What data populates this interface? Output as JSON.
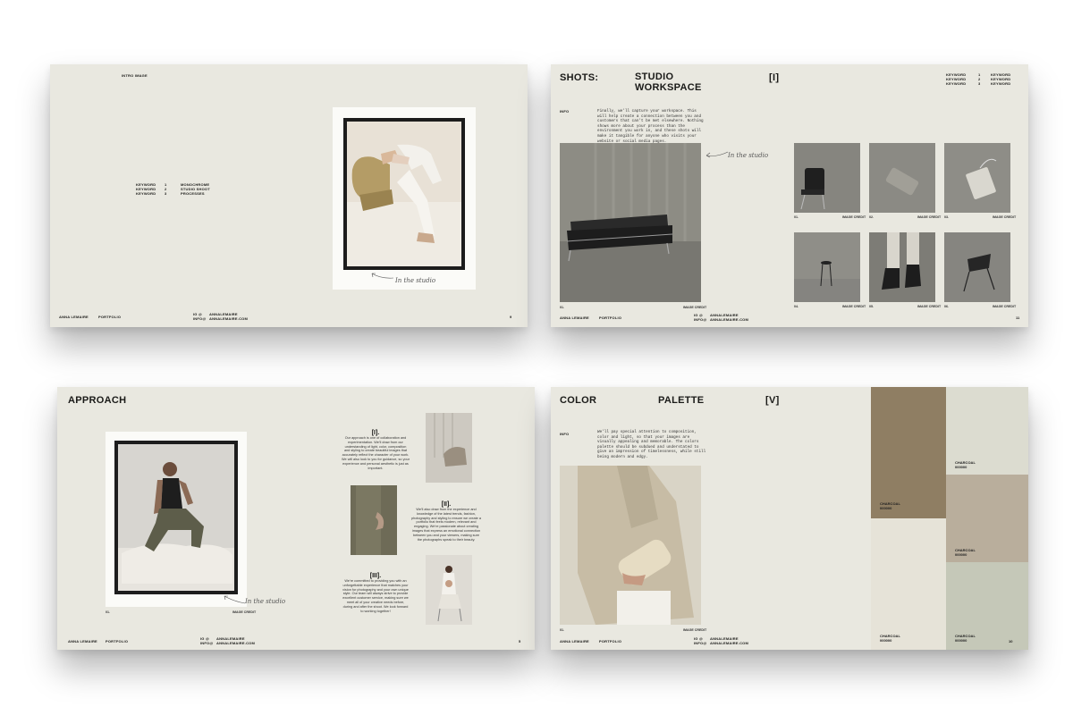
{
  "common": {
    "author": "ANNA LEMAIRE",
    "portfolio": "PORTFOLIO",
    "contact_labels": [
      "IG @",
      "INFO@"
    ],
    "contact_values": [
      "ANNALEMAIRE",
      "ANNALEMAIRE.COM"
    ],
    "studio_script": "In the studio",
    "image_credit": "IMAGE CREDIT",
    "info_label": "INFO"
  },
  "slide1": {
    "label": "INTRO IMAGE",
    "keywords_left": [
      "KEYWORD",
      "KEYWORD",
      "KEYWORD"
    ],
    "keywords_index": [
      "1",
      "2",
      "3"
    ],
    "keywords_right": [
      "MONOCHROME",
      "STUDIO SHOOT",
      "PROCESSES"
    ],
    "page": "9"
  },
  "slide2": {
    "title_left": "SHOTS:",
    "title_mid": "STUDIO WORKSPACE",
    "roman": "[I]",
    "keywords_left": [
      "KEYWORD",
      "KEYWORD",
      "KEYWORD"
    ],
    "keywords_index": [
      "1",
      "2",
      "3"
    ],
    "keywords_right": [
      "KEYWORD",
      "KEYWORD",
      "KEYWORD"
    ],
    "body": "Finally, we'll capture your workspace. This will help create a connection between you and customers that can't be met elsewhere. Nothing shows more about your process than the environment you work in, and these shots will make it tangible for anyone who visits your website or social media pages.",
    "grid_captions": [
      "01.",
      "02.",
      "03.",
      "04.",
      "05.",
      "06."
    ],
    "main_caption": "01.",
    "page": "11"
  },
  "slide3": {
    "title": "APPROACH",
    "sections": [
      {
        "roman": "[I].",
        "text": "Our approach is one of collaboration and experimentation. We'll draw from our understanding of light, color, composition and styling to create beautiful images that accurately reflect the character of your work. We will also look to you for guidance, so your experience and personal aesthetic is just as important."
      },
      {
        "roman": "[II].",
        "text": "We'll also draw from the experience and knowledge of the latest trends, fashion, photography and styling to ensure we create a portfolio that feels modern, relevant and engaging. We're passionate about creating images that express an emotional connection between you and your viewers, making sure the photographs speak to their beauty."
      },
      {
        "roman": "[III].",
        "text": "We're committed to providing you with an unforgettable experience that matches your vision for photography and your own unique style. Our team will always strive to provide excellent customer service, making sure we meet all of your creative needs before, during and after the shoot. We look forward to working together!"
      }
    ],
    "photo_caption": "01.",
    "page": "5"
  },
  "slide4": {
    "title_left": "COLOR",
    "title_mid": "PALETTE",
    "roman": "[V]",
    "body": "We'll pay special attention to composition, color and light, so that your images are visually appealing and memorable. The colors palette should be subdued and understated to give an impression of timelessness, while still being modern and edgy.",
    "caption": "01.",
    "swatches": [
      {
        "name": "CHARCOAL",
        "code": "000000",
        "color": "#8f7e63"
      },
      {
        "name": "CHARCOAL",
        "code": "000000",
        "color": "#e6e3d8"
      },
      {
        "name": "CHARCOAL",
        "code": "000000",
        "color": "#dcdcd0"
      },
      {
        "name": "CHARCOAL",
        "code": "000000",
        "color": "#b9ae9c"
      },
      {
        "name": "CHARCOAL",
        "code": "000000",
        "color": "#c5c8b8"
      }
    ],
    "page": "10"
  }
}
